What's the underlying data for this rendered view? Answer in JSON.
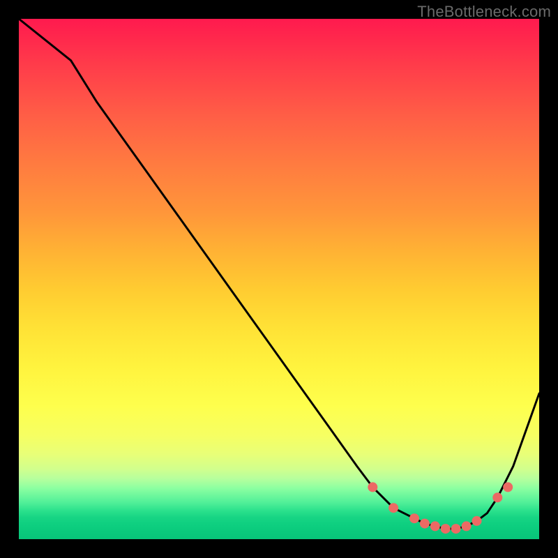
{
  "watermark": "TheBottleneck.com",
  "chart_data": {
    "type": "line",
    "title": "",
    "xlabel": "",
    "ylabel": "",
    "xlim": [
      0,
      100
    ],
    "ylim": [
      0,
      100
    ],
    "series": [
      {
        "name": "bottleneck-curve",
        "x": [
          0,
          5,
          10,
          15,
          20,
          25,
          30,
          35,
          40,
          45,
          50,
          55,
          60,
          65,
          68,
          70,
          72,
          74,
          76,
          78,
          80,
          82,
          84,
          86,
          88,
          90,
          92,
          95,
          100
        ],
        "y": [
          100,
          96,
          92,
          84,
          77,
          70,
          63,
          56,
          49,
          42,
          35,
          28,
          21,
          14,
          10,
          8,
          6,
          5,
          4,
          3,
          2.5,
          2,
          2,
          2.5,
          3.5,
          5,
          8,
          14,
          28
        ]
      }
    ],
    "dots": {
      "name": "highlight-dots",
      "x": [
        68,
        72,
        76,
        78,
        80,
        82,
        84,
        86,
        88,
        92,
        94
      ],
      "y": [
        10,
        6,
        4,
        3,
        2.5,
        2,
        2,
        2.5,
        3.5,
        8,
        10
      ]
    },
    "colors": {
      "curve": "#000000",
      "dots": "#ec6a64",
      "background_top": "#ff1a4e",
      "background_mid": "#fff33e",
      "background_bottom": "#08c67a"
    }
  }
}
